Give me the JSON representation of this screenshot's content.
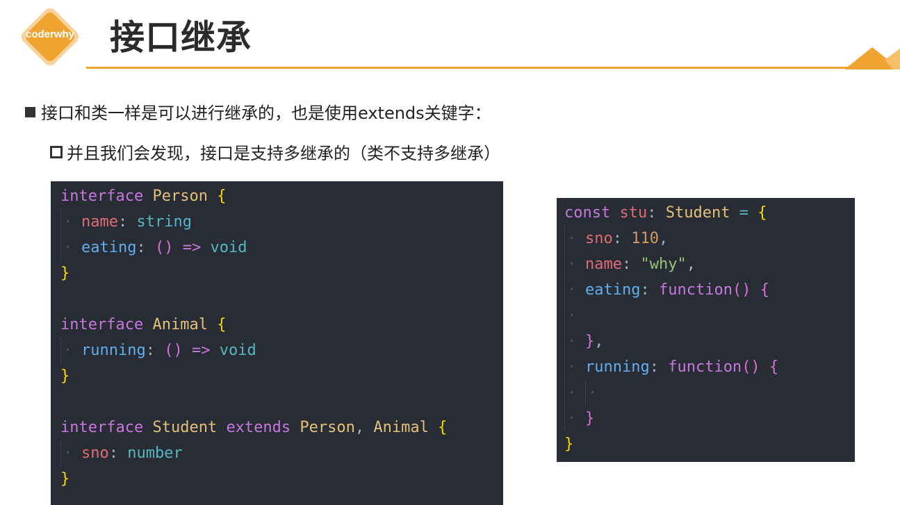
{
  "logo": {
    "text": "coderwhy",
    "color": "#f0a330"
  },
  "title": "接口继承",
  "bullets": [
    {
      "text": "接口和类一样是可以进行继承的，也是使用extends关键字："
    },
    {
      "text": "并且我们会发现，接口是支持多继承的（类不支持多继承）"
    }
  ],
  "code_left": {
    "lines": [
      "interface Person {",
      "  name: string",
      "  eating: () => void",
      "}",
      "",
      "interface Animal {",
      "  running: () => void",
      "}",
      "",
      "interface Student extends Person, Animal {",
      "  sno: number",
      "}"
    ]
  },
  "code_right": {
    "lines": [
      "const stu: Student = {",
      "  sno: 110,",
      "  name: \"why\",",
      "  eating: function() {",
      "",
      "  },",
      "  running: function() {",
      "",
      "  }",
      "}"
    ]
  },
  "colors": {
    "accent": "#f0a330",
    "code_bg": "#282c34",
    "keyword": "#c678dd",
    "type_name": "#e5c07b",
    "property": "#e06c75",
    "method": "#61afef",
    "builtin_type": "#56b6c2",
    "number": "#d19a66",
    "string": "#98c379",
    "brace": "#ffd700"
  }
}
